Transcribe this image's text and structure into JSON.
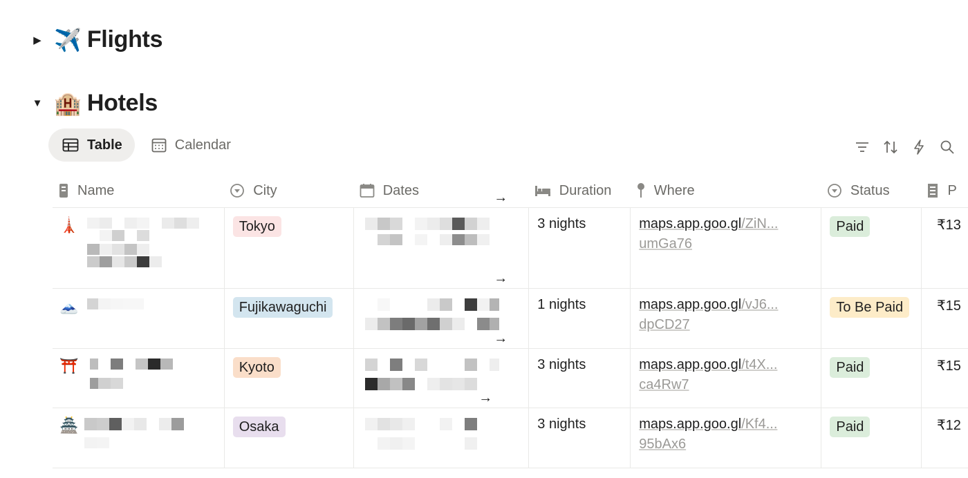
{
  "sections": [
    {
      "emoji": "✈️",
      "title": "Flights",
      "expanded": false
    },
    {
      "emoji": "🏨",
      "title": "Hotels",
      "expanded": true
    }
  ],
  "views": [
    {
      "label": "Table",
      "icon": "table-icon",
      "active": true
    },
    {
      "label": "Calendar",
      "icon": "calendar-icon",
      "active": false
    }
  ],
  "toolbar": [
    "filter-icon",
    "sort-icon",
    "automation-icon",
    "search-icon"
  ],
  "columns": [
    "Name",
    "City",
    "Dates",
    "Duration",
    "Where",
    "Status",
    "P"
  ],
  "rows": [
    {
      "emoji": "🗼",
      "city": "Tokyo",
      "city_bg": "#fbe4e4",
      "duration": "3 nights",
      "link_base": "maps.app.goo.gl",
      "link_rest": "/ZiN...",
      "link_line2": "umGa76",
      "status": "Paid",
      "status_bg": "#dbeddb",
      "price": "₹13"
    },
    {
      "emoji": "🗻",
      "city": "Fujikawaguchi",
      "city_bg": "#d3e5ef",
      "duration": "1 nights",
      "link_base": "maps.app.goo.gl",
      "link_rest": "/vJ6...",
      "link_line2": "dpCD27",
      "status": "To Be Paid",
      "status_bg": "#fdecc8",
      "price": "₹15"
    },
    {
      "emoji": "⛩️",
      "city": "Kyoto",
      "city_bg": "#fadec9",
      "duration": "3 nights",
      "link_base": "maps.app.goo.gl",
      "link_rest": "/t4X...",
      "link_line2": "ca4Rw7",
      "status": "Paid",
      "status_bg": "#dbeddb",
      "price": "₹15"
    },
    {
      "emoji": "🏯",
      "city": "Osaka",
      "city_bg": "#e8deee",
      "duration": "3 nights",
      "link_base": "maps.app.goo.gl",
      "link_rest": "/Kf4...",
      "link_line2": "95bAx6",
      "status": "Paid",
      "status_bg": "#dbeddb",
      "price": "₹12"
    }
  ],
  "arrow": "→"
}
